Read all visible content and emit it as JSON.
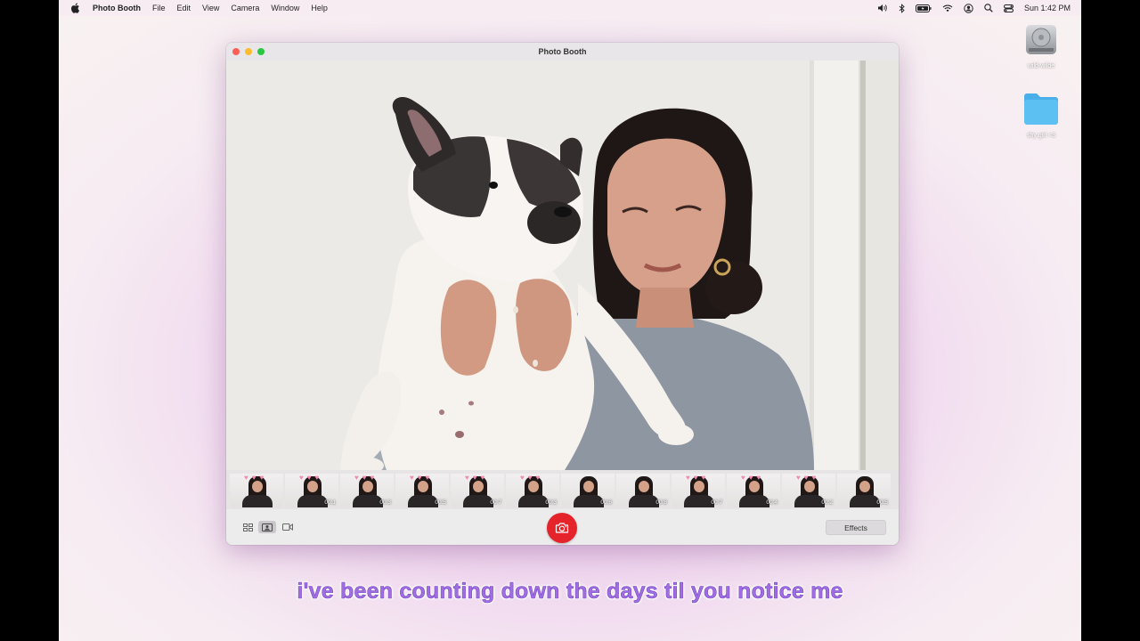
{
  "menubar": {
    "app_name": "Photo Booth",
    "menus": [
      "File",
      "Edit",
      "View",
      "Camera",
      "Window",
      "Help"
    ],
    "clock": "Sun 1:42 PM",
    "status_icons": [
      "volume-icon",
      "bluetooth-icon",
      "battery-icon",
      "wifi-icon",
      "user-icon",
      "search-icon",
      "control-center-icon"
    ]
  },
  "desktop": {
    "icons": [
      {
        "label": "wild-wilde",
        "icon": "hard-drive-icon"
      },
      {
        "label": "shy girl <3",
        "icon": "folder-icon"
      }
    ]
  },
  "window": {
    "title": "Photo Booth"
  },
  "filmstrip": {
    "thumbnails": [
      {
        "duration": "",
        "hearts": true
      },
      {
        "duration": "00:1",
        "hearts": true
      },
      {
        "duration": "00:3",
        "hearts": true
      },
      {
        "duration": "00:5",
        "hearts": true
      },
      {
        "duration": "00:7",
        "hearts": true
      },
      {
        "duration": "00:3",
        "hearts": true
      },
      {
        "duration": "00:6",
        "hearts": false
      },
      {
        "duration": "00:8",
        "hearts": false
      },
      {
        "duration": "00:7",
        "hearts": true
      },
      {
        "duration": "00:4",
        "hearts": true
      },
      {
        "duration": "00:2",
        "hearts": true
      },
      {
        "duration": "00:5",
        "hearts": false
      }
    ]
  },
  "toolbar": {
    "effects_label": "Effects",
    "view_modes": [
      "grid-view-icon",
      "single-photo-icon",
      "video-icon"
    ],
    "selected_view": "single-photo-icon",
    "shutter_color": "#e5232b"
  },
  "caption": {
    "text": "i've been counting down the days til you notice me"
  }
}
